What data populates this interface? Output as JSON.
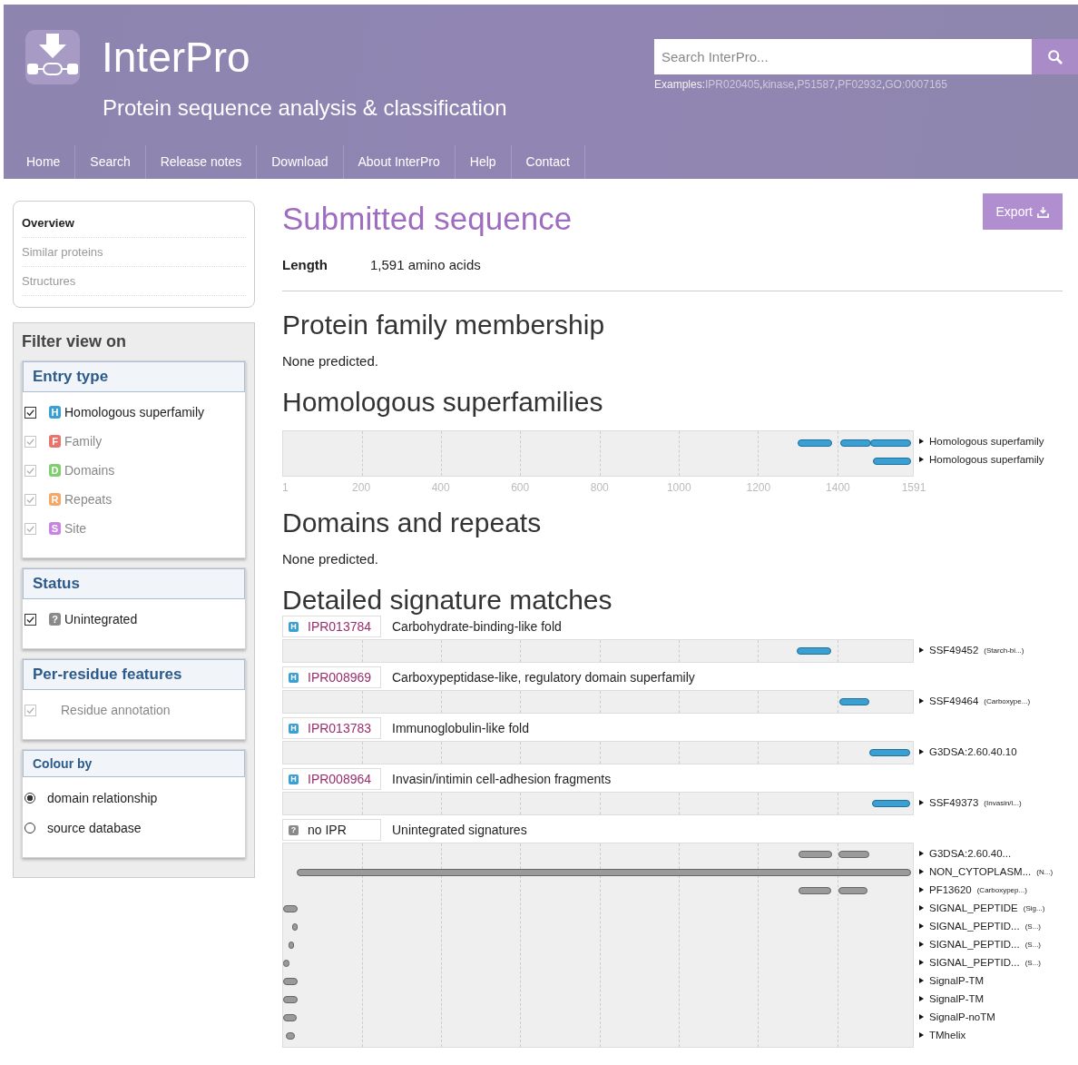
{
  "header": {
    "title": "InterPro",
    "subtitle": "Protein sequence analysis & classification",
    "search": {
      "placeholder": "Search InterPro..."
    },
    "examples_label": "Examples:",
    "separator": ",",
    "examples": [
      "IPR020405",
      "kinase",
      "P51587",
      "PF02932",
      "GO:0007165"
    ]
  },
  "nav": [
    {
      "label": "Home"
    },
    {
      "label": "Search"
    },
    {
      "label": "Release notes"
    },
    {
      "label": "Download"
    },
    {
      "label": "About InterPro"
    },
    {
      "label": "Help"
    },
    {
      "label": "Contact"
    }
  ],
  "sidebar": {
    "menu": [
      {
        "label": "Overview",
        "selected": true
      },
      {
        "label": "Similar proteins",
        "selected": false
      },
      {
        "label": "Structures",
        "selected": false
      }
    ],
    "filter_title": "Filter view on",
    "groups": [
      {
        "title": "Entry type",
        "kind": "checkbox",
        "items": [
          {
            "letter": "H",
            "color": "#3a9fd3",
            "label": "Homologous superfamily",
            "checked": true,
            "disabled": false
          },
          {
            "letter": "F",
            "color": "#e8736c",
            "label": "Family",
            "checked": true,
            "disabled": true
          },
          {
            "letter": "D",
            "color": "#7fcf6e",
            "label": "Domains",
            "checked": true,
            "disabled": true
          },
          {
            "letter": "R",
            "color": "#f5a865",
            "label": "Repeats",
            "checked": true,
            "disabled": true
          },
          {
            "letter": "S",
            "color": "#c883e3",
            "label": "Site",
            "checked": true,
            "disabled": true
          }
        ]
      },
      {
        "title": "Status",
        "kind": "checkbox",
        "items": [
          {
            "letter": "?",
            "color": "#8a8a8a",
            "label": "Unintegrated",
            "checked": true,
            "disabled": false
          }
        ]
      },
      {
        "title": "Per-residue features",
        "kind": "checkbox",
        "items": [
          {
            "label": "Residue annotation",
            "checked": true,
            "disabled": true
          }
        ]
      },
      {
        "title": "Colour by",
        "kind": "radio",
        "items": [
          {
            "label": "domain relationship",
            "selected": true
          },
          {
            "label": "source database",
            "selected": false
          }
        ]
      }
    ]
  },
  "main": {
    "title": "Submitted sequence",
    "export": "Export",
    "length_label": "Length",
    "length": "1,591 amino acids",
    "family": {
      "title": "Protein family membership",
      "text": "None predicted."
    },
    "superfamilies": {
      "title": "Homologous superfamilies",
      "ticks": [
        "1",
        "200",
        "400",
        "600",
        "800",
        "1000",
        "1200",
        "1400",
        "1591"
      ],
      "tracks": [
        {
          "name": "Homologous superfamily"
        },
        {
          "name": "Homologous superfamily"
        }
      ]
    },
    "domains": {
      "title": "Domains and repeats",
      "text": "None predicted."
    },
    "signatures": {
      "title": "Detailed signature matches",
      "entries": [
        {
          "letter": "H",
          "color": "#3a9fd3",
          "accession": "IPR013784",
          "name": "Carbohydrate-binding-like fold",
          "kind": "integrated",
          "tracks": [
            {
              "name": "SSF49452",
              "note": "(Starch-bi...)"
            }
          ]
        },
        {
          "letter": "H",
          "color": "#3a9fd3",
          "accession": "IPR008969",
          "name": "Carboxypeptidase-like, regulatory domain superfamily",
          "kind": "integrated",
          "tracks": [
            {
              "name": "SSF49464",
              "note": "(Carboxype...)"
            }
          ]
        },
        {
          "letter": "H",
          "color": "#3a9fd3",
          "accession": "IPR013783",
          "name": "Immunoglobulin-like fold",
          "kind": "integrated",
          "tracks": [
            {
              "name": "G3DSA:2.60.40.10"
            }
          ]
        },
        {
          "letter": "H",
          "color": "#3a9fd3",
          "accession": "IPR008964",
          "name": "Invasin/intimin cell-adhesion fragments",
          "kind": "integrated",
          "tracks": [
            {
              "name": "SSF49373",
              "note": "(Invasin/i...)"
            }
          ]
        },
        {
          "letter": "?",
          "color": "#8a8a8a",
          "accession": "no IPR",
          "name": "Unintegrated signatures",
          "kind": "unintegrated",
          "tracks": [
            {
              "name": "G3DSA:2.60.40..."
            },
            {
              "name": "NON_CYTOPLASM...",
              "note": "(N...)"
            },
            {
              "name": "PF13620",
              "note": "(Carboxypep...)"
            },
            {
              "name": "SIGNAL_PEPTIDE",
              "note": "(Sig...)"
            },
            {
              "name": "SIGNAL_PEPTID...",
              "note": "(S...)"
            },
            {
              "name": "SIGNAL_PEPTID...",
              "note": "(S...)"
            },
            {
              "name": "SIGNAL_PEPTID...",
              "note": "(S...)"
            },
            {
              "name": "SignalP-TM"
            },
            {
              "name": "SignalP-TM"
            },
            {
              "name": "SignalP-noTM"
            },
            {
              "name": "TMhelix"
            }
          ]
        }
      ]
    }
  }
}
